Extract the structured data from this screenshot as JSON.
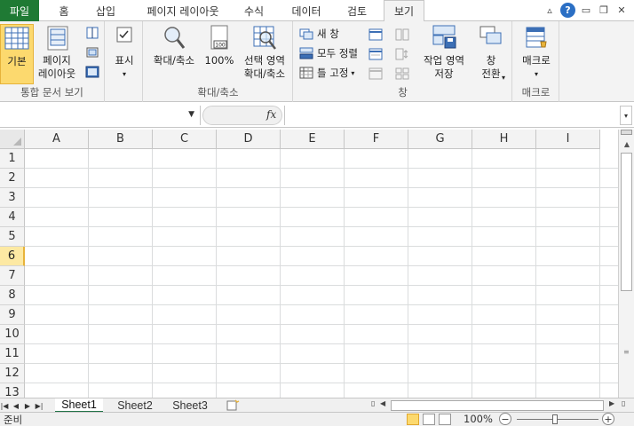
{
  "tabs": {
    "file": "파일",
    "items": [
      "홈",
      "삽입",
      "페이지 레이아웃",
      "수식",
      "데이터",
      "검토",
      "보기"
    ],
    "active_index": 6
  },
  "ribbon": {
    "workbook_views": {
      "normal_label": "기본",
      "page_layout_label": "페이지\n레이아웃",
      "group_label": "통합 문서 보기"
    },
    "show": {
      "label": "표시"
    },
    "zoom": {
      "zoom_label": "확대/축소",
      "hundred_label": "100%",
      "zoom_selection_label": "선택 영역\n확대/축소",
      "group_label": "확대/축소"
    },
    "window": {
      "new_window": "새 창",
      "arrange_all": "모두 정렬",
      "freeze_panes": "틀 고정",
      "save_workspace": "작업 영역\n저장",
      "switch_windows": "창\n전환",
      "group_label": "창"
    },
    "macros": {
      "macros_label": "매크로",
      "group_label": "매크로"
    }
  },
  "formula_bar": {
    "name_box_value": "",
    "fx_label": "fx",
    "formula_value": ""
  },
  "grid": {
    "columns": [
      "A",
      "B",
      "C",
      "D",
      "E",
      "F",
      "G",
      "H",
      "I"
    ],
    "rows": [
      "1",
      "2",
      "3",
      "4",
      "5",
      "6",
      "7",
      "8",
      "9",
      "10",
      "11",
      "12",
      "13"
    ],
    "active_row": "6"
  },
  "sheets": {
    "items": [
      "Sheet1",
      "Sheet2",
      "Sheet3"
    ],
    "active_index": 0
  },
  "status": {
    "ready_text": "준비",
    "zoom_text": "100%",
    "zoom_percent": 100
  },
  "colors": {
    "file_tab": "#1f7a34",
    "selected_button": "#fcd96e",
    "active_row_header": "#fde9a3",
    "gridline": "#dadcdd"
  }
}
